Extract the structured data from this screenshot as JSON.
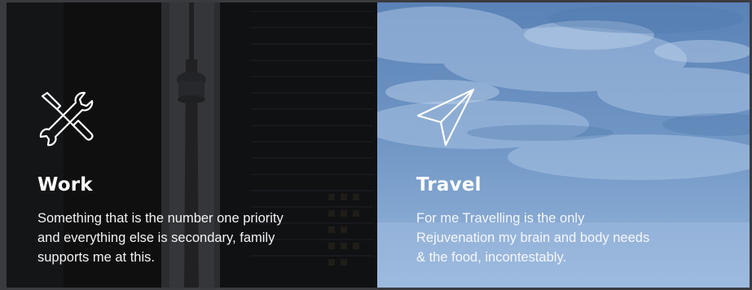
{
  "cards": [
    {
      "id": "work",
      "icon": "tools-icon",
      "title": "Work",
      "description": "Something that is the number one priority and everything else is secondary, family supports me at this."
    },
    {
      "id": "travel",
      "icon": "paper-plane-icon",
      "title": "Travel",
      "description": "For me Travelling is the only Rejuvenation my brain and body needs & the food, incontestably."
    }
  ],
  "colors": {
    "work_background": "#141416",
    "travel_background": "#7097c6",
    "text": "#ffffff",
    "page_background": "#3a3b3e"
  }
}
